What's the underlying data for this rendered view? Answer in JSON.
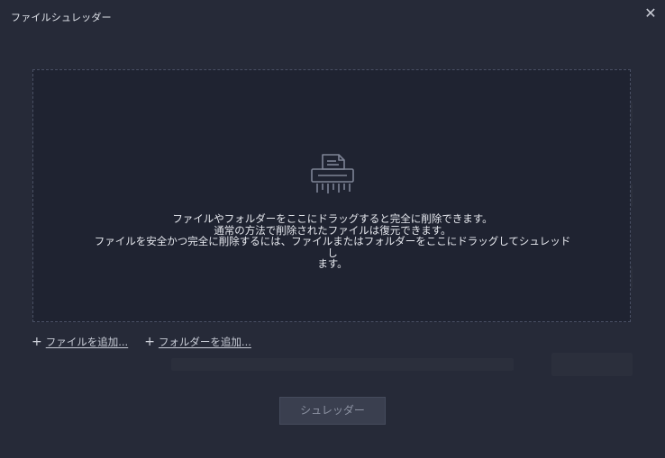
{
  "window": {
    "title": "ファイルシュレッダー",
    "close_glyph": "✕"
  },
  "drop_zone": {
    "icon": "shredder-icon",
    "lines": [
      "ファイルやフォルダーをここにドラッグすると完全に削除できます。",
      "通常の方法で削除されたファイルは復元できます。",
      "ファイルを安全かつ完全に削除するには、ファイルまたはフォルダーをここにドラッグしてシュレッドし",
      "ます。"
    ]
  },
  "actions": {
    "add_file": {
      "plus": "+",
      "label": "ファイルを追加..."
    },
    "add_folder": {
      "plus": "+",
      "label": "フォルダーを追加..."
    }
  },
  "shred_button": {
    "label": "シュレッダー",
    "enabled": false
  },
  "colors": {
    "background": "#262a38",
    "drop_zone": "#1f2331",
    "button": "#3a3f4f"
  }
}
